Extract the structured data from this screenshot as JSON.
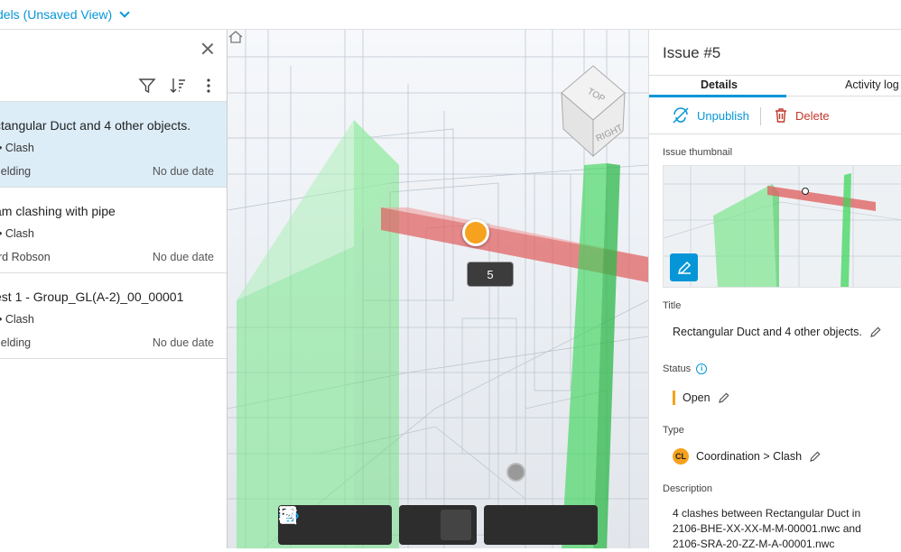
{
  "topbar": {
    "view_title": "dels (Unsaved View)"
  },
  "issues": [
    {
      "title": "ctangular Duct and 4 other objects.",
      "type": "• Clash",
      "owner": "ielding",
      "due": "No due date",
      "selected": true
    },
    {
      "title": "am clashing with pipe",
      "type": "• Clash",
      "owner": "rd Robson",
      "due": "No due date",
      "selected": false
    },
    {
      "title": "est 1 - Group_GL(A-2)_00_00001",
      "type": "• Clash",
      "owner": "ielding",
      "due": "No due date",
      "selected": false
    }
  ],
  "viewer": {
    "marker_label": "5",
    "viewcube_top": "TOP",
    "viewcube_right": "RIGHT"
  },
  "details": {
    "issue_title": "Issue #5",
    "tabs": {
      "details": "Details",
      "activity": "Activity log"
    },
    "actions": {
      "unpublish": "Unpublish",
      "delete": "Delete"
    },
    "thumbnail_label": "Issue thumbnail",
    "title_label": "Title",
    "title_value": "Rectangular Duct and 4 other objects.",
    "status_label": "Status",
    "status_value": "Open",
    "type_label": "Type",
    "type_badge": "CL",
    "type_value": "Coordination > Clash",
    "description_label": "Description",
    "description_value": "4 clashes between Rectangular Duct in 2106-BHE-XX-XX-M-M-00001.nwc and 2106-SRA-20-ZZ-M-A-00001.nwc"
  },
  "colors": {
    "accent": "#0696d7",
    "selected_row": "#dcedf8",
    "marker": "#f6a21e",
    "delete": "#c0392b"
  }
}
